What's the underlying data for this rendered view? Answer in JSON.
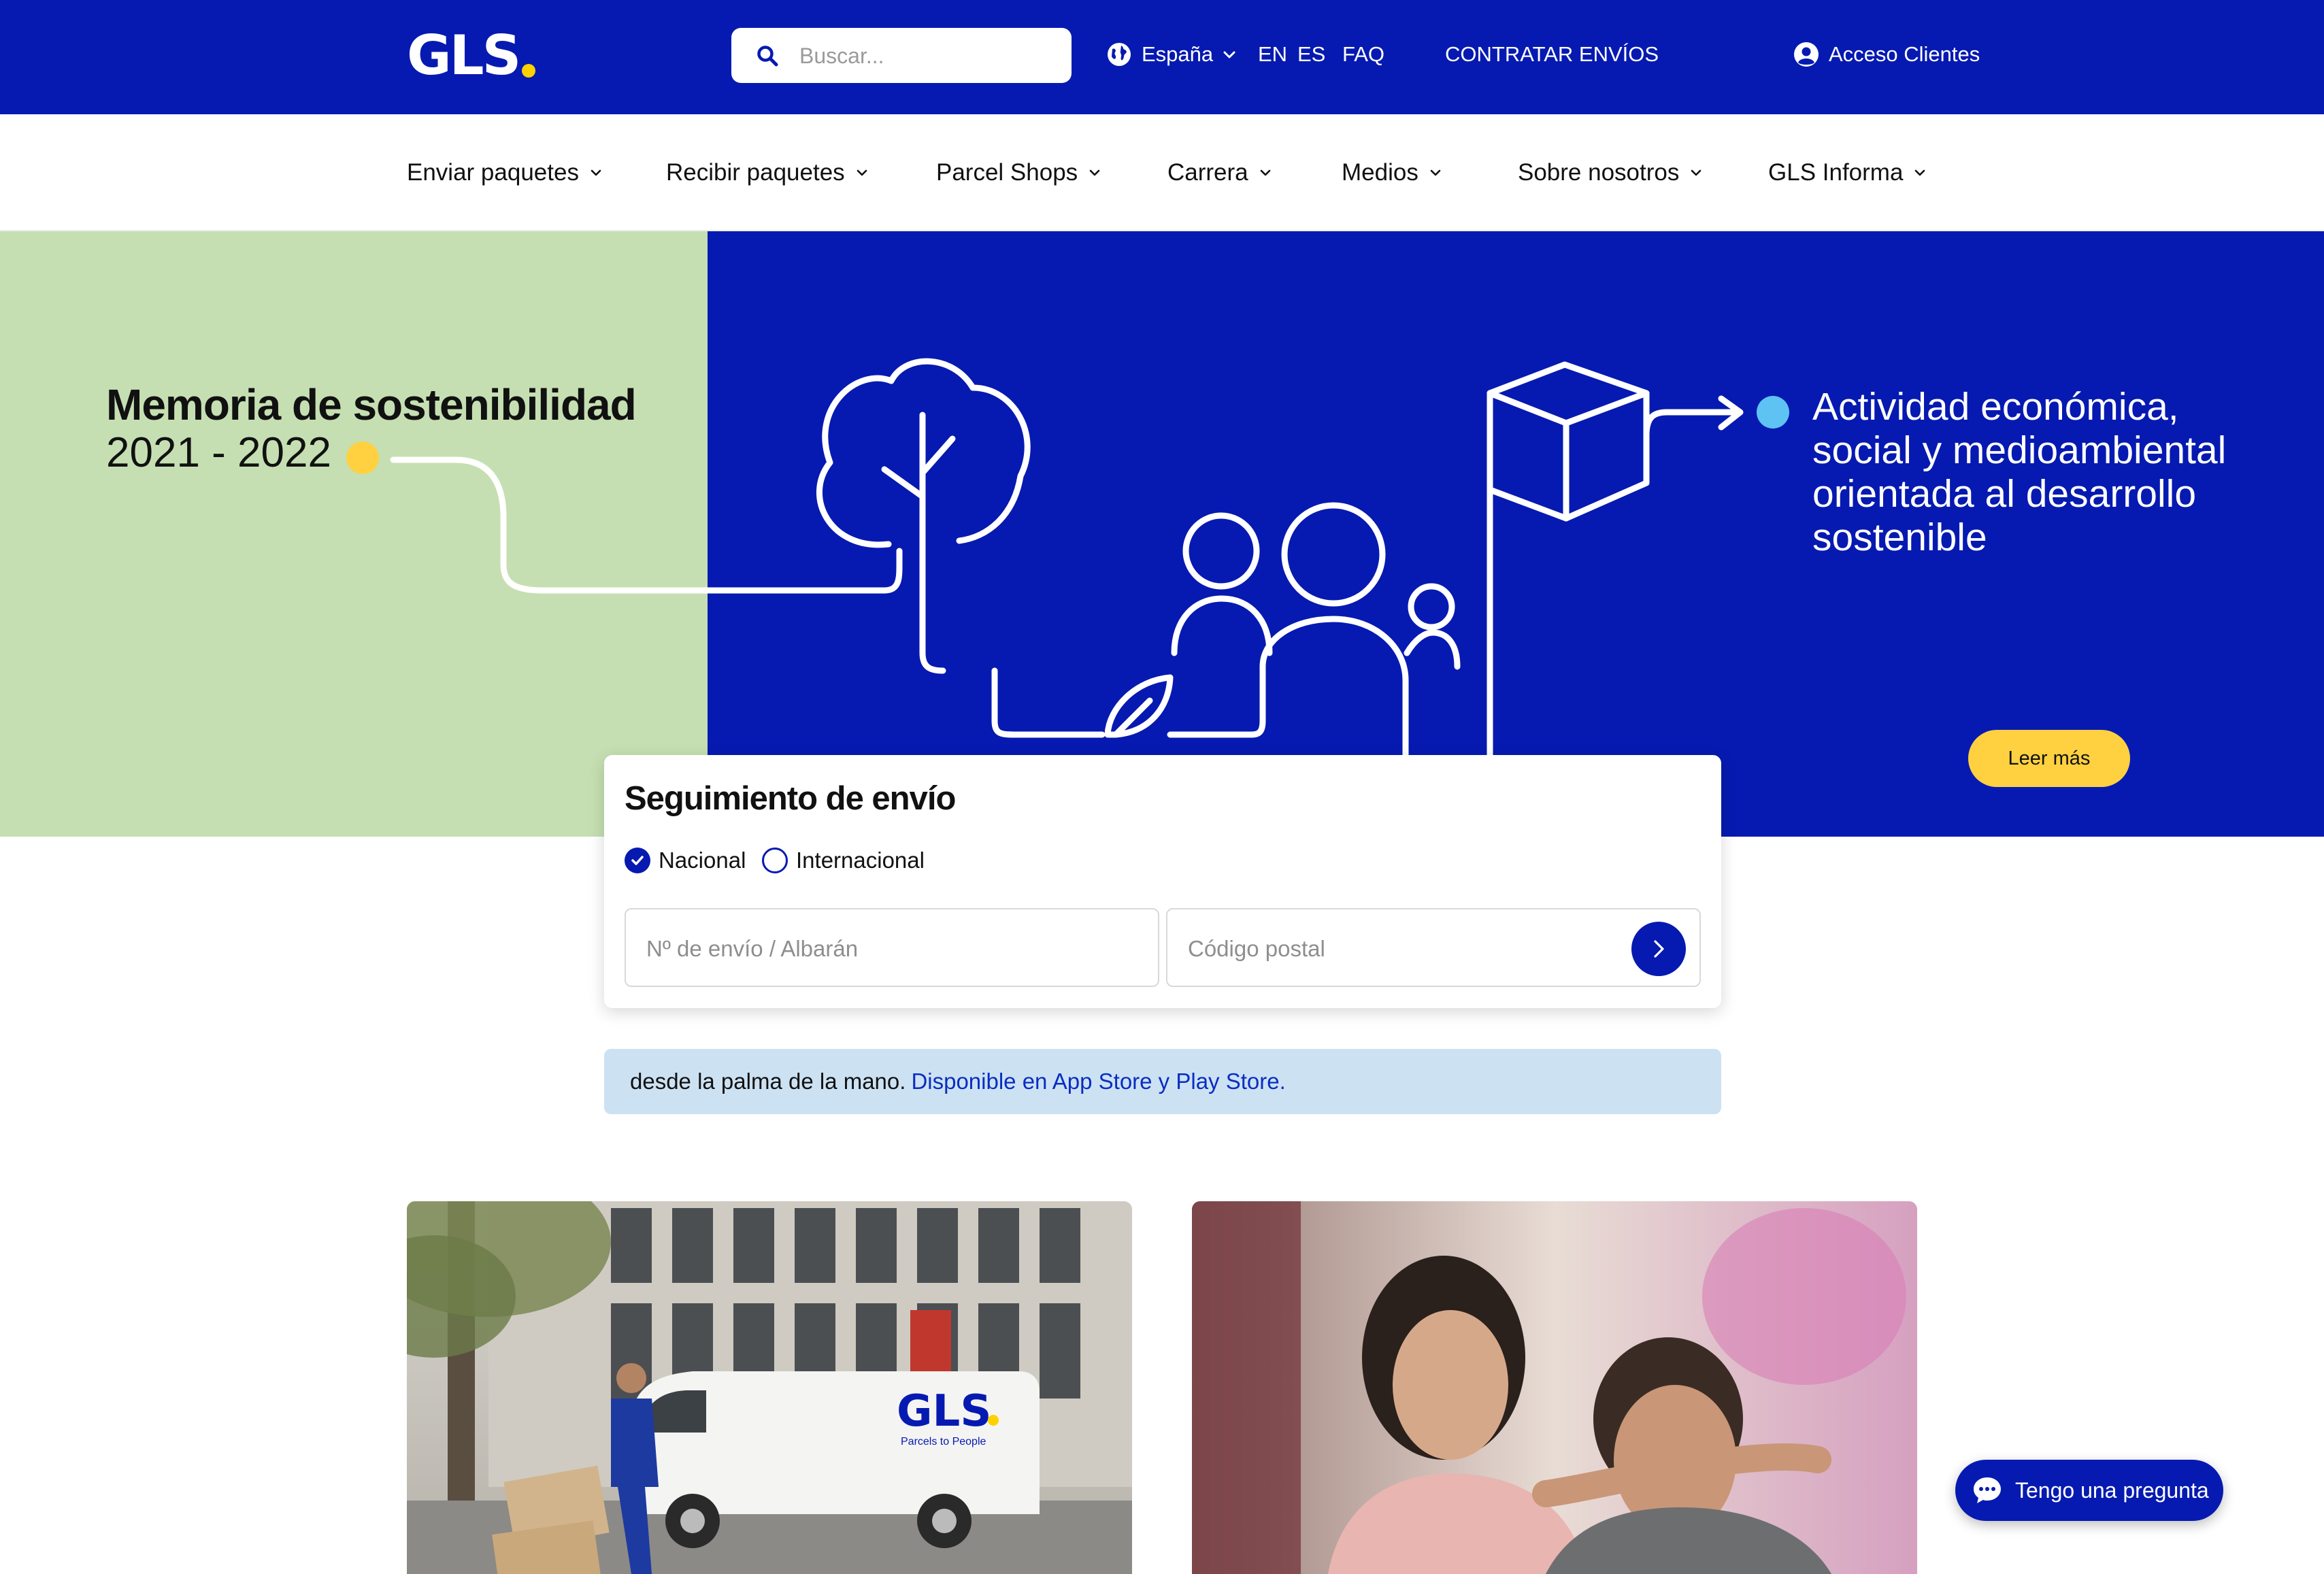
{
  "header": {
    "logo_text": "GLS",
    "search_placeholder": "Buscar...",
    "country": "España",
    "languages": [
      "EN",
      "ES"
    ],
    "faq": "FAQ",
    "contract": "CONTRATAR ENVÍOS",
    "login": "Acceso Clientes"
  },
  "nav": {
    "items": [
      {
        "label": "Enviar paquetes"
      },
      {
        "label": "Recibir paquetes"
      },
      {
        "label": "Parcel Shops"
      },
      {
        "label": "Carrera"
      },
      {
        "label": "Medios"
      },
      {
        "label": "Sobre nosotros"
      },
      {
        "label": "GLS Informa"
      }
    ]
  },
  "hero": {
    "title": "Memoria de sostenibilidad",
    "years": "2021 - 2022",
    "tagline": "Actividad económica, social y medioambiental orientada al desarrollo sostenible",
    "cta": "Leer más"
  },
  "tracking": {
    "title": "Seguimiento de envío",
    "options": [
      {
        "label": "Nacional",
        "selected": true
      },
      {
        "label": "Internacional",
        "selected": false
      }
    ],
    "shipment_placeholder": "Nº de envío / Albarán",
    "postal_placeholder": "Código postal"
  },
  "app_banner": {
    "text": "desde la palma de la mano.",
    "link": "Disponible en App Store y Play Store."
  },
  "cards": [
    {
      "van_brand": "GLS",
      "van_slogan": "Parcels to People"
    },
    {}
  ],
  "chat": {
    "label": "Tengo una pregunta"
  },
  "colors": {
    "brand_blue": "#061ab1",
    "brand_yellow": "#ffd100",
    "hero_green": "#c5dfb2",
    "cta_yellow": "#ffd140",
    "app_banner_bg": "#cce2f3"
  }
}
